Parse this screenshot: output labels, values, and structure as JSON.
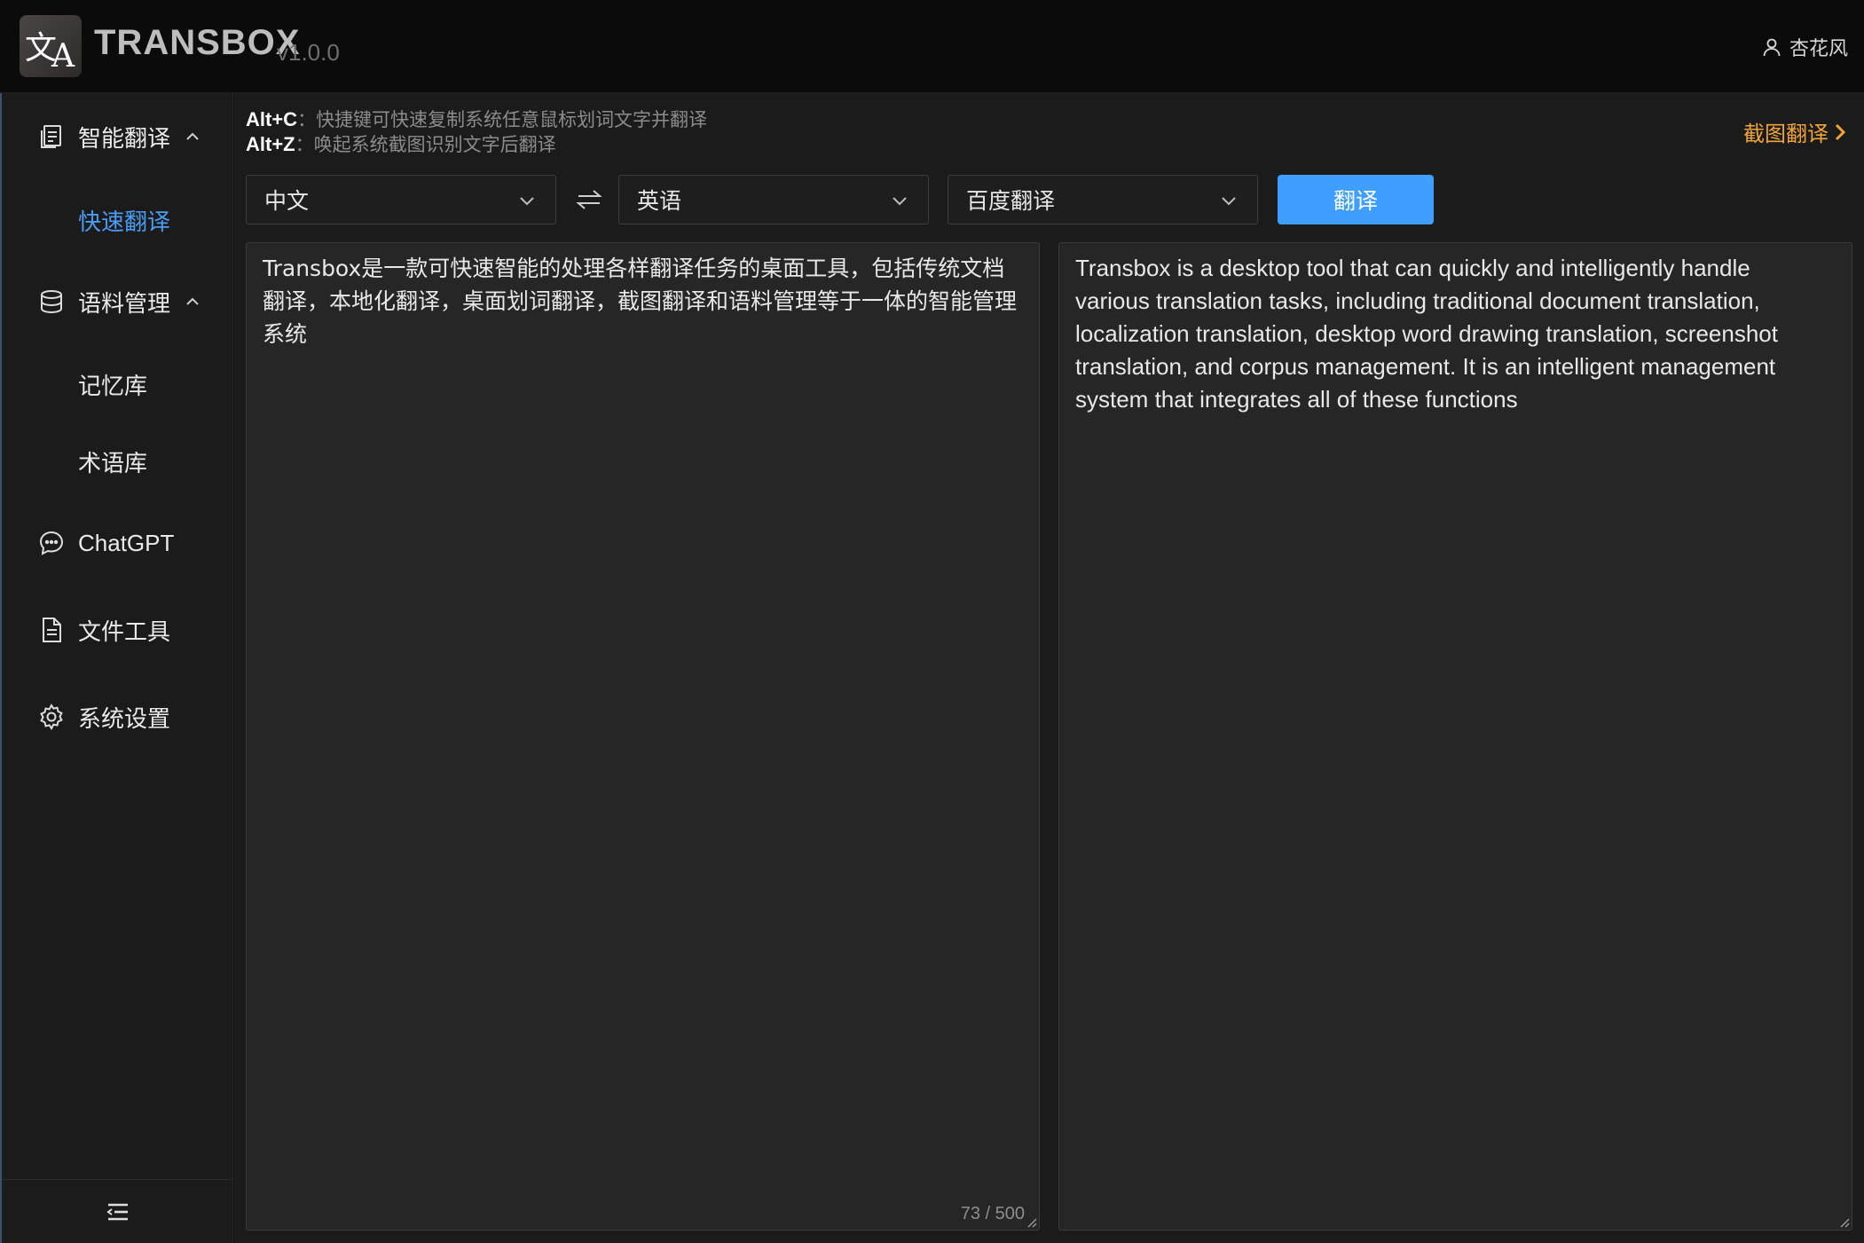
{
  "header": {
    "app_name": "TRANSBOX",
    "version": "v1.0.0",
    "user_name": "杏花风",
    "logo_glyphs": [
      "文",
      "A"
    ]
  },
  "sidebar": {
    "groups": [
      {
        "label": "智能翻译",
        "icon": "document-icon",
        "expanded": true,
        "children": [
          {
            "label": "快速翻译",
            "active": true
          }
        ]
      },
      {
        "label": "语料管理",
        "icon": "database-icon",
        "expanded": true,
        "children": [
          {
            "label": "记忆库",
            "active": false
          },
          {
            "label": "术语库",
            "active": false
          }
        ]
      },
      {
        "label": "ChatGPT",
        "icon": "chat-icon"
      },
      {
        "label": "文件工具",
        "icon": "file-icon"
      },
      {
        "label": "系统设置",
        "icon": "gear-icon"
      }
    ],
    "footer_icon": "collapse-menu-icon"
  },
  "hints": [
    {
      "key": "Alt+C",
      "text": "快捷键可快速复制系统任意鼠标划词文字并翻译"
    },
    {
      "key": "Alt+Z",
      "text": "唤起系统截图识别文字后翻译"
    }
  ],
  "screenshot_link": "截图翻译",
  "toolbar": {
    "source_language": "中文",
    "target_language": "英语",
    "engine": "百度翻译",
    "translate_label": "翻译"
  },
  "source_text": "Transbox是一款可快速智能的处理各样翻译任务的桌面工具，包括传统文档翻译，本地化翻译，桌面划词翻译，截图翻译和语料管理等于一体的智能管理系统",
  "char_count": "73 / 500",
  "translated_text": "Transbox is a desktop tool that can quickly and intelligently handle various translation tasks, including traditional document translation, localization translation, desktop word drawing translation, screenshot translation, and corpus management. It is an intelligent management system that integrates all of these functions",
  "colors": {
    "accent": "#409eff",
    "active_nav": "#4a9cf5",
    "link_orange": "#f0a43a",
    "background": "#1b1b1b"
  }
}
